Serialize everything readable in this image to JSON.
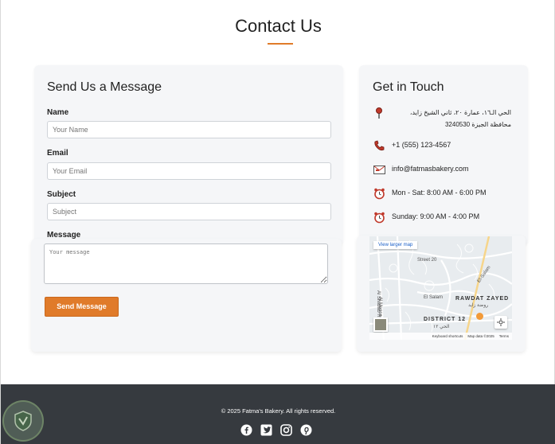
{
  "header": {
    "title": "Contact Us",
    "accent_color": "#e07b2a"
  },
  "form": {
    "heading": "Send Us a Message",
    "name_label": "Name",
    "name_placeholder": "Your Name",
    "email_label": "Email",
    "email_placeholder": "Your Email",
    "subject_label": "Subject",
    "subject_placeholder": "Subject",
    "message_label": "Message",
    "message_placeholder": "Your message",
    "submit_label": "Send Message"
  },
  "info": {
    "heading": "Get in Touch",
    "items": [
      {
        "icon": "location-pin-icon",
        "text": "الحي الـ١٦، عمارة ٢٠، ثاني الشيخ زايد، محافظة الجيزة 3240530"
      },
      {
        "icon": "phone-icon",
        "text": "+1 (555) 123-4567"
      },
      {
        "icon": "envelope-icon",
        "text": "info@fatmasbakery.com"
      },
      {
        "icon": "alarm-clock-icon",
        "text": "Mon - Sat: 8:00 AM - 6:00 PM"
      },
      {
        "icon": "alarm-clock-icon",
        "text": "Sunday: 9:00 AM - 4:00 PM"
      }
    ]
  },
  "map": {
    "larger_map_link": "View larger map",
    "labels": {
      "street20": "Street 20",
      "el_salam": "El-Salam",
      "el_salam2": "El Salam",
      "al_shabab": "Al Shabab Rd",
      "al_messa": "Al Messa",
      "rawdat_zayed": "RAWDAT ZAYED",
      "rawdat_zayed_ar": "روضة زايد",
      "district12": "DISTRICT 12",
      "district12_ar": "الحي ١٢"
    },
    "footer": {
      "shortcuts": "Keyboard shortcuts",
      "data": "Map data ©2025",
      "terms": "Terms"
    }
  },
  "footer": {
    "copyright": "© 2025 Fatma's Bakery. All rights reserved.",
    "social": [
      "facebook-icon",
      "twitter-icon",
      "instagram-icon",
      "pinterest-icon"
    ],
    "background": "#363a3f"
  }
}
